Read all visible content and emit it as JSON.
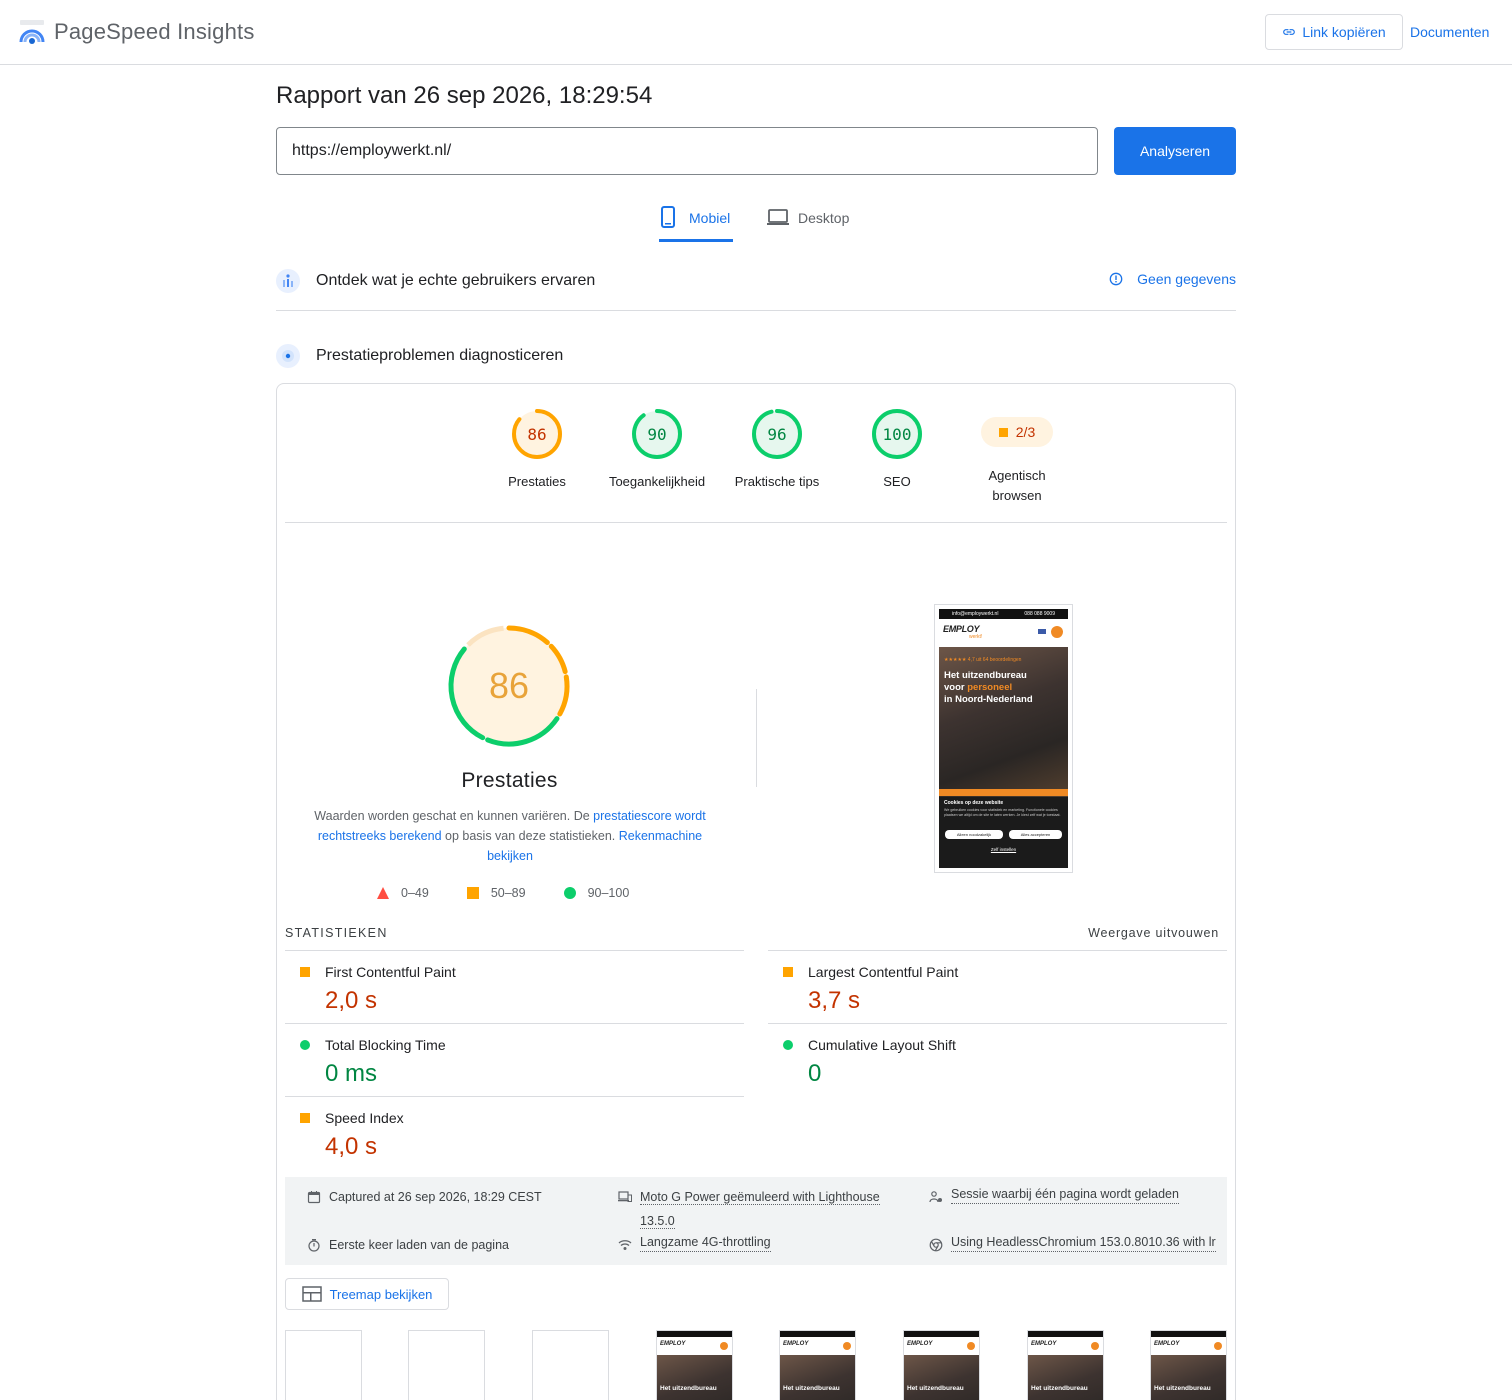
{
  "header": {
    "app_title": "PageSpeed Insights",
    "copy_link": "Link kopiëren",
    "docs": "Documenten"
  },
  "report": {
    "title": "Rapport van 26 sep 2026, 18:29:54",
    "url": "https://employwerkt.nl/",
    "analyze": "Analyseren"
  },
  "tabs": [
    {
      "label": "Mobiel",
      "active": true
    },
    {
      "label": "Desktop",
      "active": false
    }
  ],
  "field_section": {
    "title": "Ontdek wat je echte gebruikers ervaren",
    "no_data": "Geen gegevens"
  },
  "lab_section": {
    "title": "Prestatieproblemen diagnosticeren"
  },
  "categories": [
    {
      "label": "Prestaties",
      "score": "86",
      "value": 86,
      "color": "#ffa400",
      "text_color": "#c33300",
      "bg": "#fff3e0"
    },
    {
      "label": "Toegankelijkheid",
      "score": "90",
      "value": 90,
      "color": "#0cce6b",
      "text_color": "#018642",
      "bg": "#e6f7ee"
    },
    {
      "label": "Praktische tips",
      "score": "96",
      "value": 96,
      "color": "#0cce6b",
      "text_color": "#018642",
      "bg": "#e6f7ee"
    },
    {
      "label": "SEO",
      "score": "100",
      "value": 100,
      "color": "#0cce6b",
      "text_color": "#018642",
      "bg": "#e6f7ee"
    },
    {
      "label": "Agentisch browsen",
      "score": "2/3"
    }
  ],
  "performance": {
    "score": "86",
    "title": "Prestaties",
    "desc_1": "Waarden worden geschat en kunnen variëren. De ",
    "desc_link_1": "prestatiescore wordt rechtstreeks berekend",
    "desc_2": " op basis van deze statistieken. ",
    "desc_link_2": "Rekenmachine bekijken",
    "legend": [
      "0–49",
      "50–89",
      "90–100"
    ],
    "colors": {
      "fail": "#ff4e42",
      "average": "#ffa400",
      "pass": "#0cce6b"
    }
  },
  "screenshot": {
    "top_bar_email": "info@employwerkt.nl",
    "top_bar_phone": "088 088 9009",
    "logo": "EMPLOY",
    "logo_sub": "werkt!",
    "rating": "★★★★★ 4,7 uit 64 beoordelingen",
    "hero_line1": "Het uitzendbureau",
    "hero_line2_a": "voor ",
    "hero_line2_b": "personeel",
    "hero_line3": "in Noord-Nederland",
    "cookie_title": "Cookies op deze website",
    "cookie_text": "We gebruiken cookies voor statistiek en marketing. Functionele cookies plaatsen we altijd om de site te laten werken. Je kiest zelf wat je toestaat.",
    "cookie_btn_1": "Alleen noodzakelijk",
    "cookie_btn_2": "Alles accepteren",
    "cookie_settings": "Zelf instellen"
  },
  "stats": {
    "heading": "STATISTIEKEN",
    "expand": "Weergave uitvouwen",
    "metrics": [
      {
        "name": "First Contentful Paint",
        "value": "2,0 s",
        "rating": "average"
      },
      {
        "name": "Largest Contentful Paint",
        "value": "3,7 s",
        "rating": "average"
      },
      {
        "name": "Total Blocking Time",
        "value": "0 ms",
        "rating": "pass"
      },
      {
        "name": "Cumulative Layout Shift",
        "value": "0",
        "rating": "pass"
      },
      {
        "name": "Speed Index",
        "value": "4,0 s",
        "rating": "average"
      }
    ]
  },
  "run_info": {
    "captured": "Captured at 26 sep 2026, 18:29 CEST",
    "device_1": "Moto G Power geëmuleerd with Lighthouse",
    "device_2": "13.5.0",
    "session": "Sessie waarbij één pagina wordt geladen",
    "load": "Eerste keer laden van de pagina",
    "throttling": "Langzame 4G-throttling",
    "browser": "Using HeadlessChromium 153.0.8010.36 with lr"
  },
  "treemap": "Treemap bekijken",
  "filmstrip": {
    "frame_logo": "EMPLOY",
    "frame_heading": "Het uitzendbureau"
  }
}
